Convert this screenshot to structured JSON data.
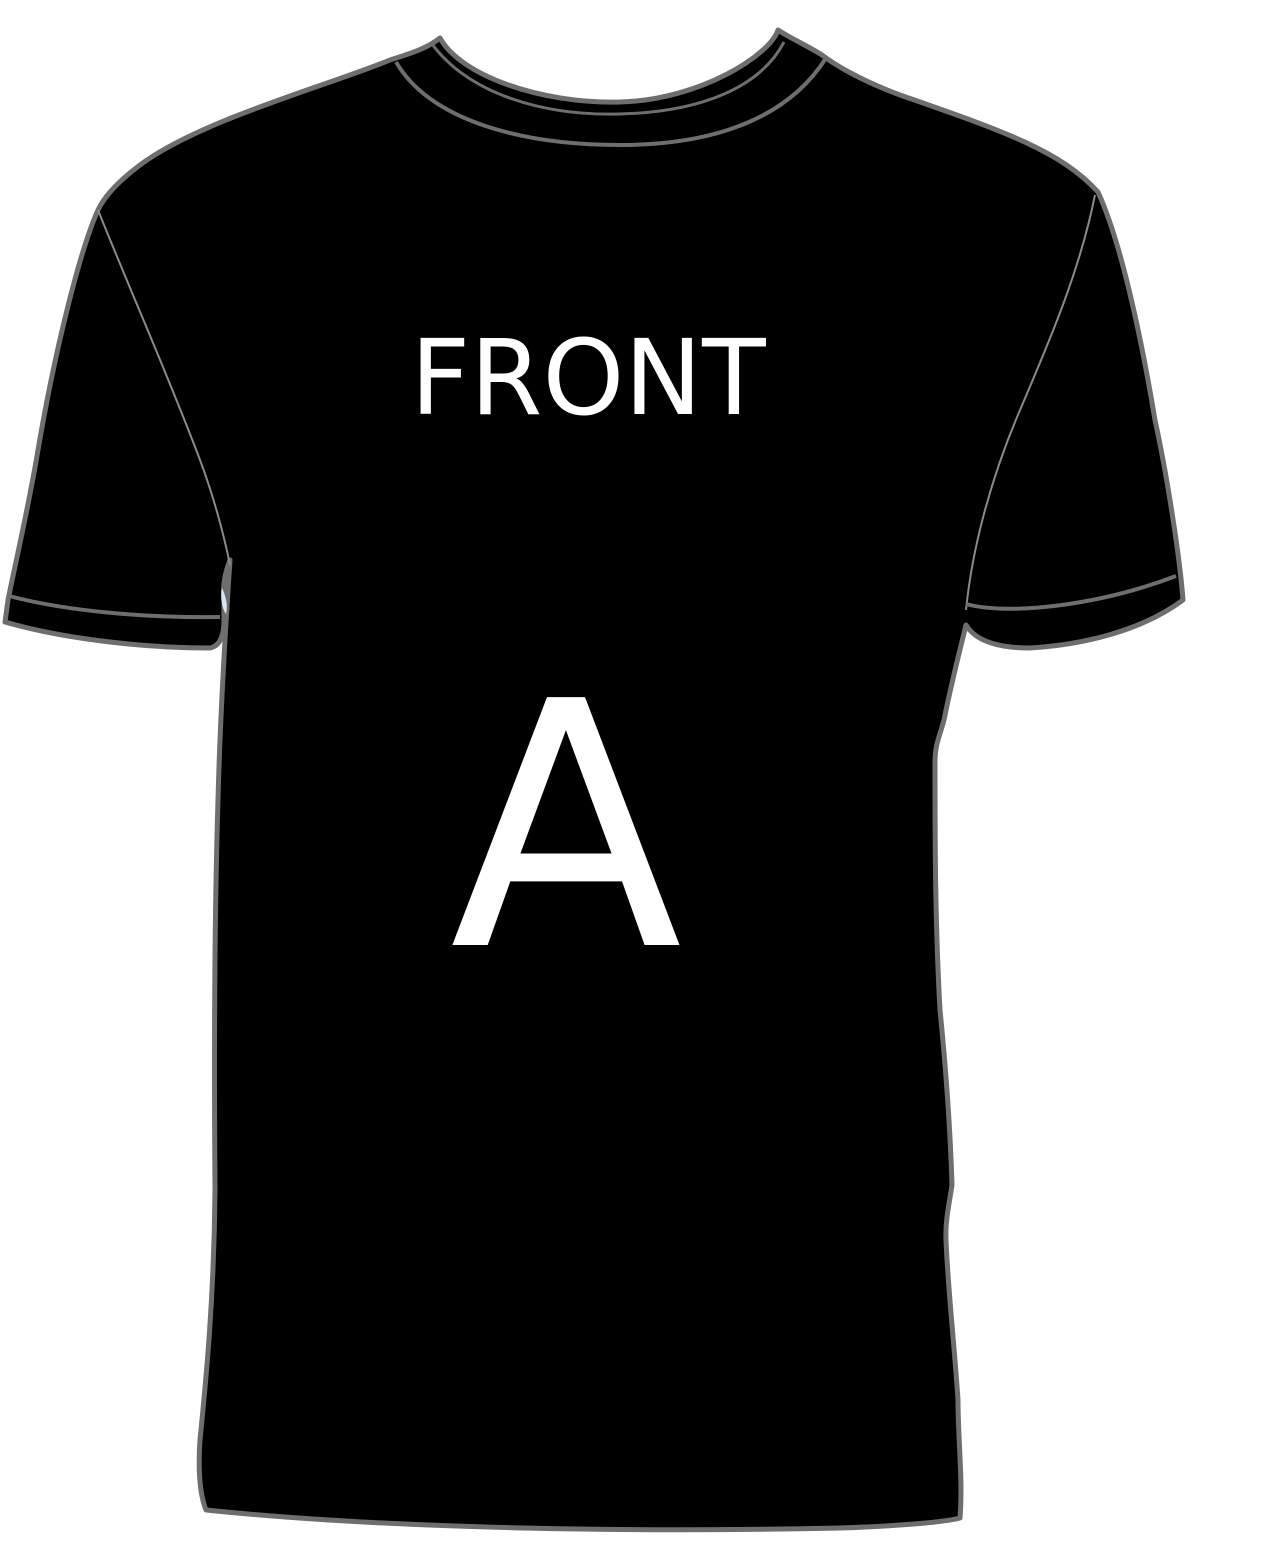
{
  "garment": {
    "view_label": "FRONT",
    "print_letter": "A"
  },
  "colors": {
    "shirt_fill": "#000000",
    "outline": "#6e6e6e",
    "seam": "#8a8a8a",
    "text": "#ffffff",
    "background": "#ffffff"
  }
}
